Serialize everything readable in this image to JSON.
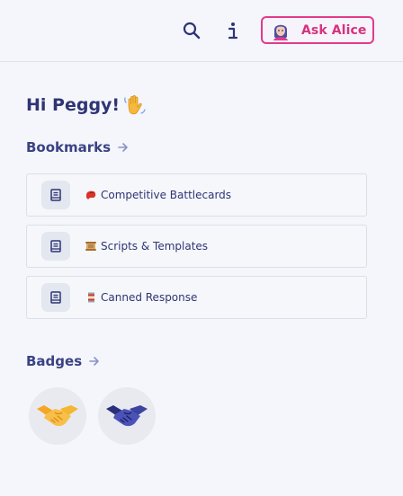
{
  "header": {
    "ask_button_label": "Ask Alice",
    "icons": [
      "search-icon",
      "info-icon",
      "alice-avatar-icon"
    ]
  },
  "greeting": {
    "text": "Hi Peggy!",
    "emoji": "waving-hand"
  },
  "bookmarks": {
    "title": "Bookmarks",
    "items": [
      {
        "emoji": "boxing-glove",
        "label": "Competitive Battlecards"
      },
      {
        "emoji": "scroll",
        "label": "Scripts & Templates"
      },
      {
        "emoji": "canned-food",
        "label": "Canned Response"
      }
    ]
  },
  "badges": {
    "title": "Badges",
    "items": [
      {
        "name": "handshake-gold",
        "color": "#f5b731"
      },
      {
        "name": "handshake-navy",
        "color": "#2a2f7a"
      }
    ]
  },
  "colors": {
    "primary_text": "#2f3474",
    "accent_pink": "#e23a8c",
    "background": "#f4f6fb"
  }
}
